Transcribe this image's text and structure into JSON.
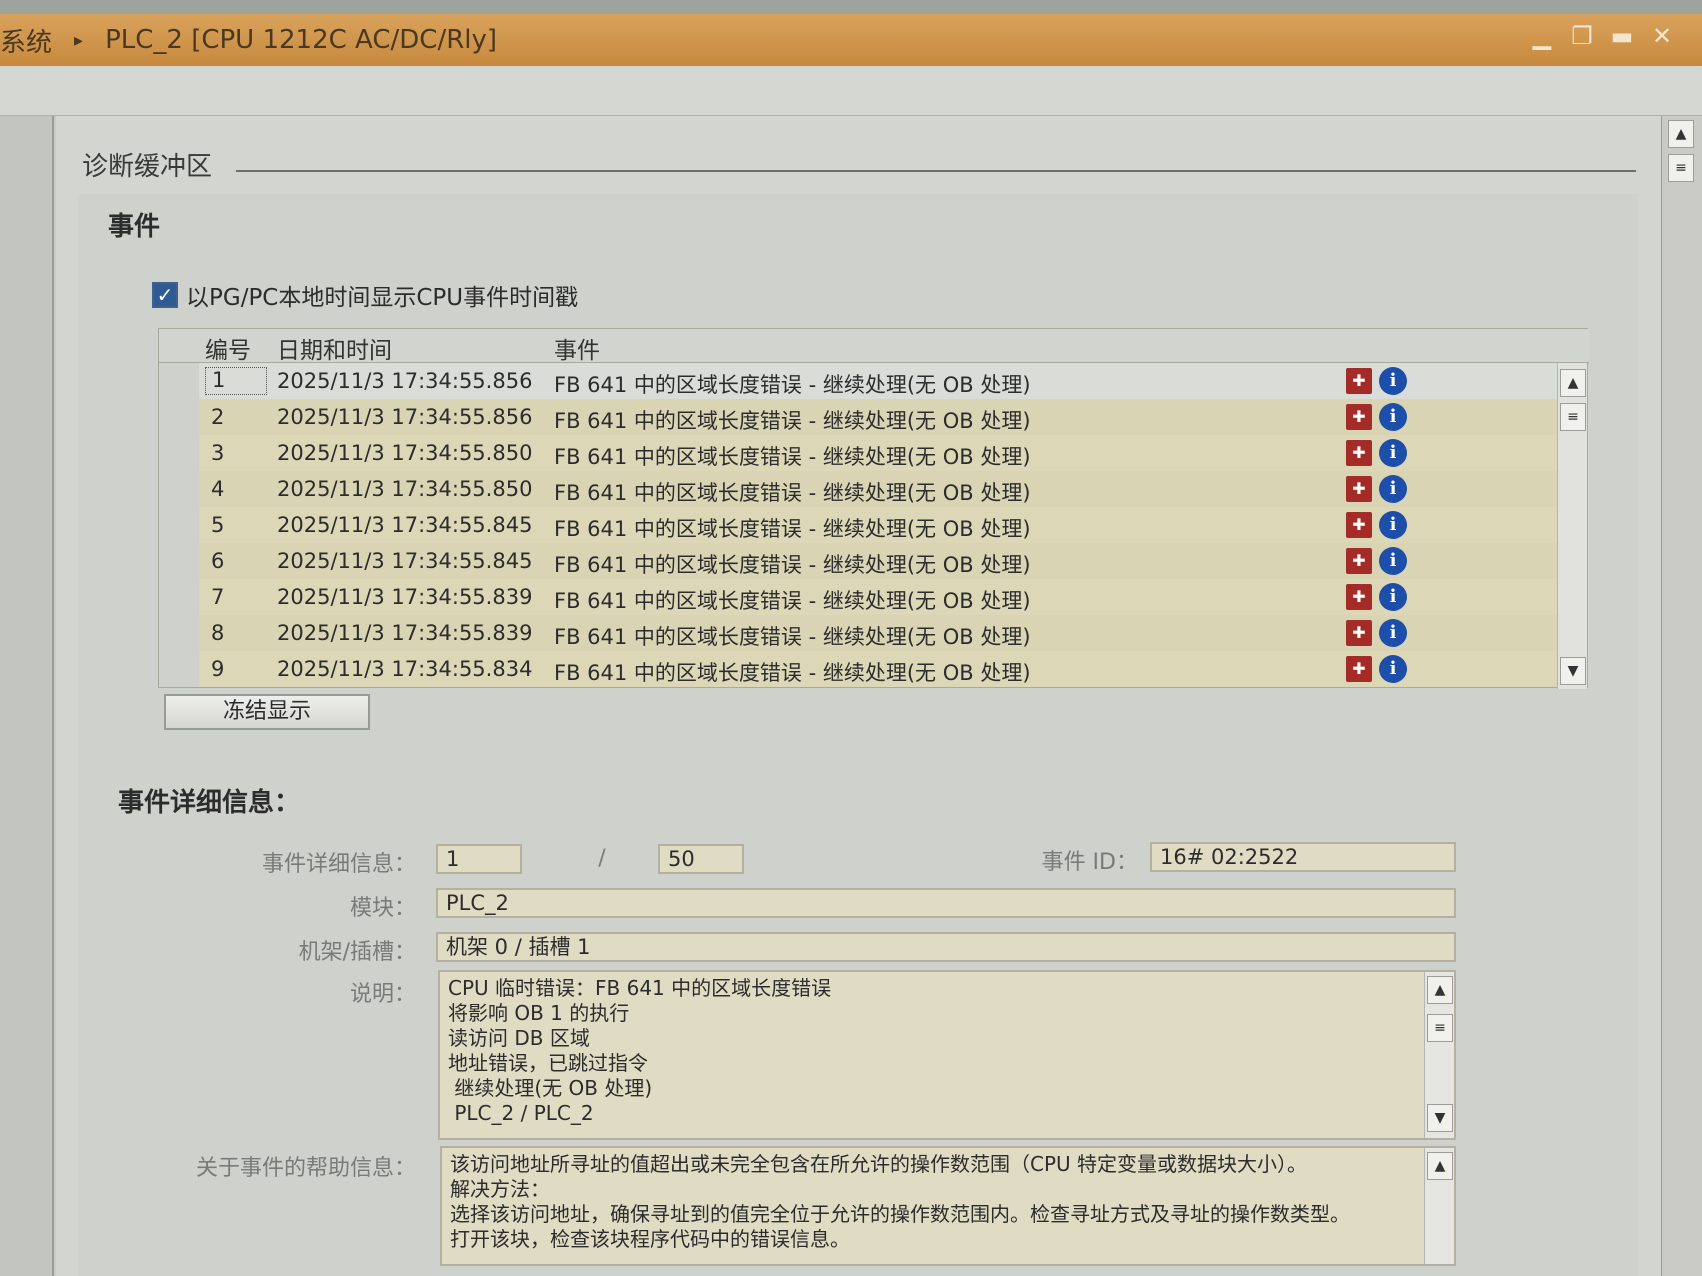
{
  "titlebar": {
    "root": "系统",
    "separator": "▸",
    "device": "PLC_2 [CPU 1212C AC/DC/Rly]"
  },
  "section": {
    "title": "诊断缓冲区",
    "events_heading": "事件"
  },
  "options": {
    "local_time_label": "以PG/PC本地时间显示CPU事件时间戳",
    "local_time_checked": true
  },
  "table": {
    "headers": {
      "num": "编号",
      "datetime": "日期和时间",
      "event": "事件"
    },
    "rows": [
      {
        "num": "1",
        "datetime": "2025/11/3 17:34:55.856",
        "event": "FB 641 中的区域长度错误 - 继续处理(无 OB 处理)"
      },
      {
        "num": "2",
        "datetime": "2025/11/3 17:34:55.856",
        "event": "FB 641 中的区域长度错误 - 继续处理(无 OB 处理)"
      },
      {
        "num": "3",
        "datetime": "2025/11/3 17:34:55.850",
        "event": "FB 641 中的区域长度错误 - 继续处理(无 OB 处理)"
      },
      {
        "num": "4",
        "datetime": "2025/11/3 17:34:55.850",
        "event": "FB 641 中的区域长度错误 - 继续处理(无 OB 处理)"
      },
      {
        "num": "5",
        "datetime": "2025/11/3 17:34:55.845",
        "event": "FB 641 中的区域长度错误 - 继续处理(无 OB 处理)"
      },
      {
        "num": "6",
        "datetime": "2025/11/3 17:34:55.845",
        "event": "FB 641 中的区域长度错误 - 继续处理(无 OB 处理)"
      },
      {
        "num": "7",
        "datetime": "2025/11/3 17:34:55.839",
        "event": "FB 641 中的区域长度错误 - 继续处理(无 OB 处理)"
      },
      {
        "num": "8",
        "datetime": "2025/11/3 17:34:55.839",
        "event": "FB 641 中的区域长度错误 - 继续处理(无 OB 处理)"
      },
      {
        "num": "9",
        "datetime": "2025/11/3 17:34:55.834",
        "event": "FB 641 中的区域长度错误 - 继续处理(无 OB 处理)"
      }
    ],
    "icons": {
      "error": "wrench-error-icon",
      "info": "info-icon"
    },
    "colors": {
      "error": "#a52b28",
      "info": "#1d4eaa"
    }
  },
  "buttons": {
    "freeze": "冻结显示"
  },
  "details": {
    "heading": "事件详细信息：",
    "event_detail_label": "事件详细信息：",
    "event_index": "1",
    "separator": "/",
    "event_total": "50",
    "event_id_label": "事件 ID：",
    "event_id": "16# 02:2522",
    "module_label": "模块：",
    "module": "PLC_2",
    "rack_slot_label": "机架/插槽：",
    "rack_slot": "机架 0 / 插槽 1",
    "description_label": "说明：",
    "description_lines": [
      "CPU 临时错误：FB 641 中的区域长度错误",
      "将影响 OB 1 的执行",
      "读访问 DB 区域",
      "地址错误，已跳过指令",
      " 继续处理(无 OB 处理)",
      "",
      " PLC_2 / PLC_2"
    ],
    "help_label": "关于事件的帮助信息：",
    "help_lines": [
      "该访问地址所寻址的值超出或未完全包含在所允许的操作数范围（CPU 特定变量或数据块大小）。",
      "解决方法：",
      "选择该访问地址，确保寻址到的值完全位于允许的操作数范围内。检查寻址方式及寻址的操作数类型。",
      "打开该块，检查该块程序代码中的错误信息。"
    ]
  }
}
